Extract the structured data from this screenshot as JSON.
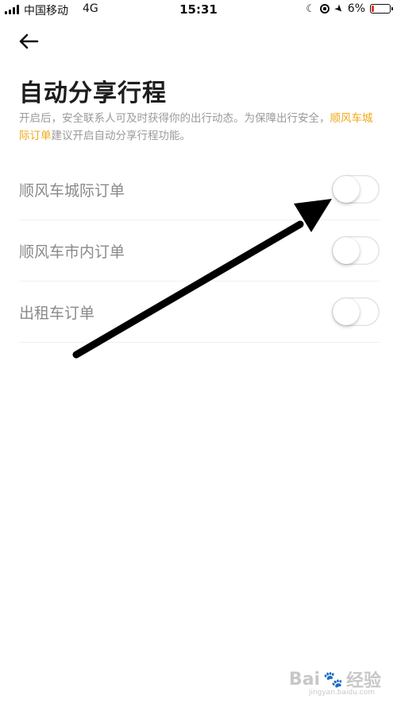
{
  "status_bar": {
    "carrier": "中国移动",
    "network": "4G",
    "time": "15:31",
    "battery": "6%",
    "icons": [
      "signal-icon",
      "moon-icon",
      "orientation-lock-icon",
      "location-icon",
      "battery-icon"
    ]
  },
  "header": {
    "back_icon": "arrow-left-icon",
    "title": "自动分享行程",
    "description_prefix": "开启后，安全联系人可及时获得你的出行动态。为保障出行安全，",
    "description_highlight": "顺风车城际订单",
    "description_suffix": "建议开启自动分享行程功能。"
  },
  "settings": [
    {
      "label": "顺风车城际订单",
      "enabled": false
    },
    {
      "label": "顺风车市内订单",
      "enabled": false
    },
    {
      "label": "出租车订单",
      "enabled": false
    }
  ],
  "colors": {
    "accent": "#f0a818",
    "title": "#1d1d1d",
    "label": "#8a8a8a",
    "description": "#9a9a9a",
    "battery_low": "#e33a2d"
  },
  "watermark": {
    "brand": "Bai",
    "brand_suffix": "经验",
    "url": "jingyan.baidu.com"
  }
}
